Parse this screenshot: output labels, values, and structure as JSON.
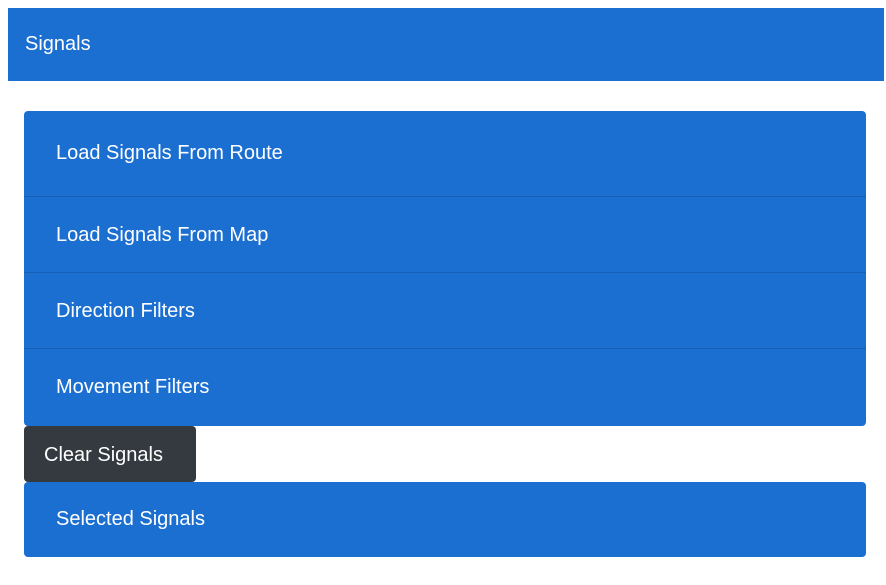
{
  "panel": {
    "title": "Signals"
  },
  "accordion": {
    "items": [
      {
        "label": "Load Signals From Route"
      },
      {
        "label": "Load Signals From Map"
      },
      {
        "label": "Direction Filters"
      },
      {
        "label": "Movement Filters"
      }
    ]
  },
  "actions": {
    "clear_label": "Clear Signals"
  },
  "selected": {
    "label": "Selected Signals"
  },
  "colors": {
    "primary": "#1b6fd0",
    "dark": "#343a40",
    "text": "#ffffff"
  }
}
